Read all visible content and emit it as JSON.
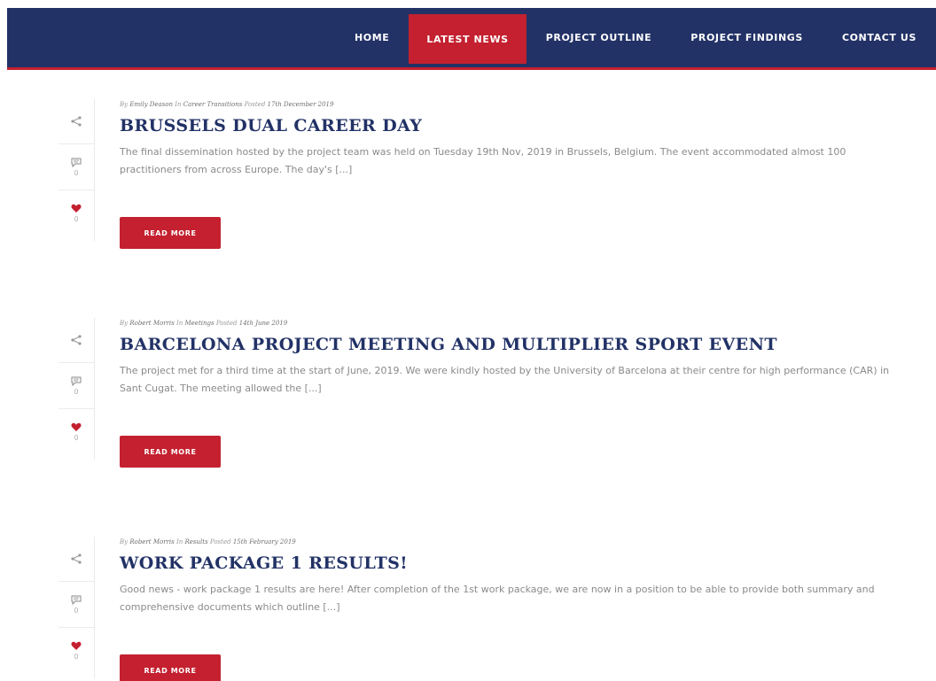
{
  "nav": {
    "items": [
      {
        "label": "HOME",
        "active": false
      },
      {
        "label": "LATEST NEWS",
        "active": true
      },
      {
        "label": "PROJECT OUTLINE",
        "active": false
      },
      {
        "label": "PROJECT FINDINGS",
        "active": false
      },
      {
        "label": "CONTACT US",
        "active": false
      }
    ]
  },
  "colors": {
    "navy": "#223266",
    "accent": "#c4202f"
  },
  "posts": [
    {
      "meta": {
        "by": "By",
        "author": "Emily Deason",
        "in": "In",
        "category": "Career Transitions",
        "posted": "Posted",
        "date": "17th December 2019"
      },
      "title": "BRUSSELS DUAL CAREER DAY",
      "excerpt": "The final dissemination hosted by the project team was held on Tuesday 19th Nov, 2019 in Brussels, Belgium. The event accommodated almost 100 practitioners from across Europe. The day's [...]",
      "comments": "0",
      "likes": "0",
      "read_more": "READ MORE"
    },
    {
      "meta": {
        "by": "By",
        "author": "Robert Morris",
        "in": "In",
        "category": "Meetings",
        "posted": "Posted",
        "date": "14th June 2019"
      },
      "title": "BARCELONA PROJECT MEETING AND MULTIPLIER SPORT EVENT",
      "excerpt": "The project met for a third time at the start of June, 2019. We were kindly hosted by the University of Barcelona at their centre for high performance (CAR) in Sant Cugat. The meeting allowed the [...]",
      "comments": "0",
      "likes": "0",
      "read_more": "READ MORE"
    },
    {
      "meta": {
        "by": "By",
        "author": "Robert Morris",
        "in": "In",
        "category": "Results",
        "posted": "Posted",
        "date": "15th February 2019"
      },
      "title": "WORK PACKAGE 1 RESULTS!",
      "excerpt": "Good news - work package 1 results are here! After completion of the 1st work package, we are now in a position to be able to provide both summary and comprehensive documents which outline [...]",
      "comments": "0",
      "likes": "0",
      "read_more": "READ MORE"
    }
  ]
}
